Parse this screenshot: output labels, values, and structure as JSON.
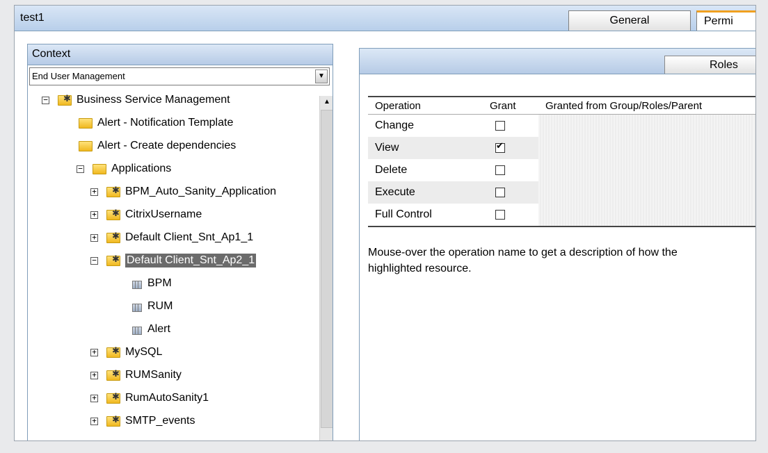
{
  "window": {
    "title": "test1"
  },
  "tabs": [
    {
      "label": "General"
    },
    {
      "label": "Permi"
    }
  ],
  "context": {
    "header": "Context",
    "dropdown_value": "End User Management"
  },
  "tree": [
    {
      "label": "Business Service Management",
      "toggle": "−",
      "icon": "folder-star",
      "level": 0
    },
    {
      "label": "Alert - Notification Template",
      "toggle": "",
      "icon": "folder",
      "level": 1
    },
    {
      "label": "Alert - Create dependencies",
      "toggle": "",
      "icon": "folder",
      "level": 1
    },
    {
      "label": "Applications",
      "toggle": "−",
      "icon": "folder",
      "level": 1
    },
    {
      "label": "BPM_Auto_Sanity_Application",
      "toggle": "+",
      "icon": "folder-star",
      "level": 2
    },
    {
      "label": "CitrixUsername",
      "toggle": "+",
      "icon": "folder-star",
      "level": 2
    },
    {
      "label": "Default Client_Snt_Ap1_1",
      "toggle": "+",
      "icon": "folder-star",
      "level": 2
    },
    {
      "label": "Default Client_Snt_Ap2_1",
      "toggle": "−",
      "icon": "folder-star",
      "level": 2,
      "selected": true
    },
    {
      "label": "BPM",
      "toggle": "",
      "icon": "leaf",
      "level": 3
    },
    {
      "label": "RUM",
      "toggle": "",
      "icon": "leaf",
      "level": 3
    },
    {
      "label": "Alert",
      "toggle": "",
      "icon": "leaf",
      "level": 3
    },
    {
      "label": "MySQL",
      "toggle": "+",
      "icon": "folder-star",
      "level": 2
    },
    {
      "label": "RUMSanity",
      "toggle": "+",
      "icon": "folder-star",
      "level": 2
    },
    {
      "label": "RumAutoSanity1",
      "toggle": "+",
      "icon": "folder-star",
      "level": 2
    },
    {
      "label": "SMTP_events",
      "toggle": "+",
      "icon": "folder-star",
      "level": 2
    }
  ],
  "permissions": {
    "roles_tab": "Roles",
    "columns": [
      "Operation",
      "Grant",
      "Granted from Group/Roles/Parent"
    ],
    "operations": [
      {
        "name": "Change",
        "granted": false
      },
      {
        "name": "View",
        "granted": true
      },
      {
        "name": "Delete",
        "granted": false
      },
      {
        "name": "Execute",
        "granted": false
      },
      {
        "name": "Full Control",
        "granted": false
      }
    ],
    "help_text_1": "Mouse-over the operation name to get a description of how the",
    "help_text_2": "highlighted resource."
  }
}
